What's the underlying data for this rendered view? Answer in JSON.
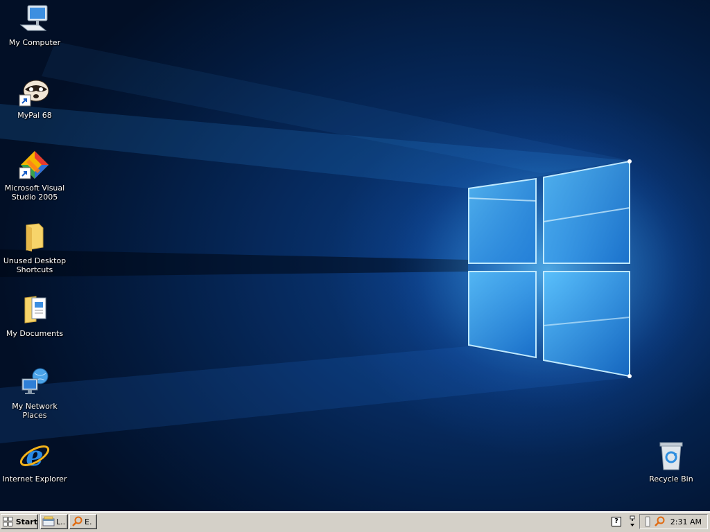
{
  "desktop": {
    "icons": [
      {
        "label": "My Computer",
        "icon": "computer-icon"
      },
      {
        "label": "MyPal 68",
        "icon": "mypal-icon"
      },
      {
        "label": "Microsoft Visual Studio 2005",
        "icon": "visual-studio-icon"
      },
      {
        "label": "Unused Desktop Shortcuts",
        "icon": "folder-icon"
      },
      {
        "label": "My Documents",
        "icon": "documents-folder-icon"
      },
      {
        "label": "My Network Places",
        "icon": "network-places-icon"
      },
      {
        "label": "Internet Explorer",
        "icon": "internet-explorer-icon"
      },
      {
        "label": "Recycle Bin",
        "icon": "recycle-bin-icon"
      }
    ]
  },
  "taskbar": {
    "start_label": "Start",
    "tasks": [
      {
        "label": "L..",
        "icon": "explorer-window-icon"
      },
      {
        "label": "E.",
        "icon": "search-magnifier-icon"
      }
    ],
    "quick_launch_icon": "help-icon",
    "tray_icons": [
      "network-icon",
      "volume-icon",
      "usb-icon",
      "search-magnifier-icon"
    ],
    "clock": "2:31 AM"
  },
  "colors": {
    "wallpaper_dark": "#031a3d",
    "wallpaper_glow": "#3aa7ff",
    "taskbar_face": "#d4d0c8"
  }
}
